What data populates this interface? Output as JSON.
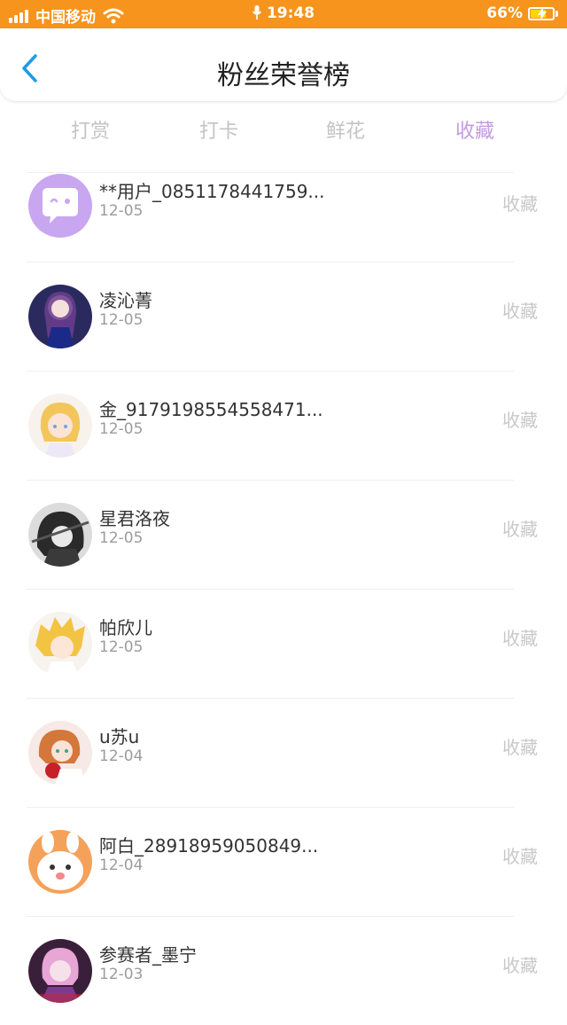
{
  "status_bar": {
    "carrier": "中国移动",
    "time": "19:48",
    "battery": "66%",
    "battery_level": 0.66,
    "colors": {
      "background": "#f7941d",
      "text": "#ffffff"
    }
  },
  "header": {
    "title": "粉丝荣誉榜",
    "back_icon": "chevron-left-icon",
    "accent": "#1f9be6"
  },
  "tabs": [
    {
      "label": "打赏",
      "active": false
    },
    {
      "label": "打卡",
      "active": false
    },
    {
      "label": "鲜花",
      "active": false
    },
    {
      "label": "收藏",
      "active": true
    }
  ],
  "tab_active_color": "#c59be0",
  "entries": [
    {
      "name": "**用户_0851178441759...",
      "date": "12-05",
      "action": "收藏",
      "avatar": "purple-chat-bubble-avatar"
    },
    {
      "name": "凌沁菁",
      "date": "12-05",
      "action": "收藏",
      "avatar": "anime-girl-dark-avatar"
    },
    {
      "name": "金_9179198554558471...",
      "date": "12-05",
      "action": "收藏",
      "avatar": "anime-blonde-girl-avatar"
    },
    {
      "name": "星君洛夜",
      "date": "12-05",
      "action": "收藏",
      "avatar": "anime-monochrome-avatar"
    },
    {
      "name": "帕欣儿",
      "date": "12-05",
      "action": "收藏",
      "avatar": "anime-blonde-boy-avatar"
    },
    {
      "name": "u苏u",
      "date": "12-04",
      "action": "收藏",
      "avatar": "anime-redhead-avatar"
    },
    {
      "name": "阿白_28918959050849...",
      "date": "12-04",
      "action": "收藏",
      "avatar": "orange-bunny-avatar"
    },
    {
      "name": "参赛者_墨宁",
      "date": "12-03",
      "action": "收藏",
      "avatar": "anime-pink-hair-avatar"
    }
  ]
}
